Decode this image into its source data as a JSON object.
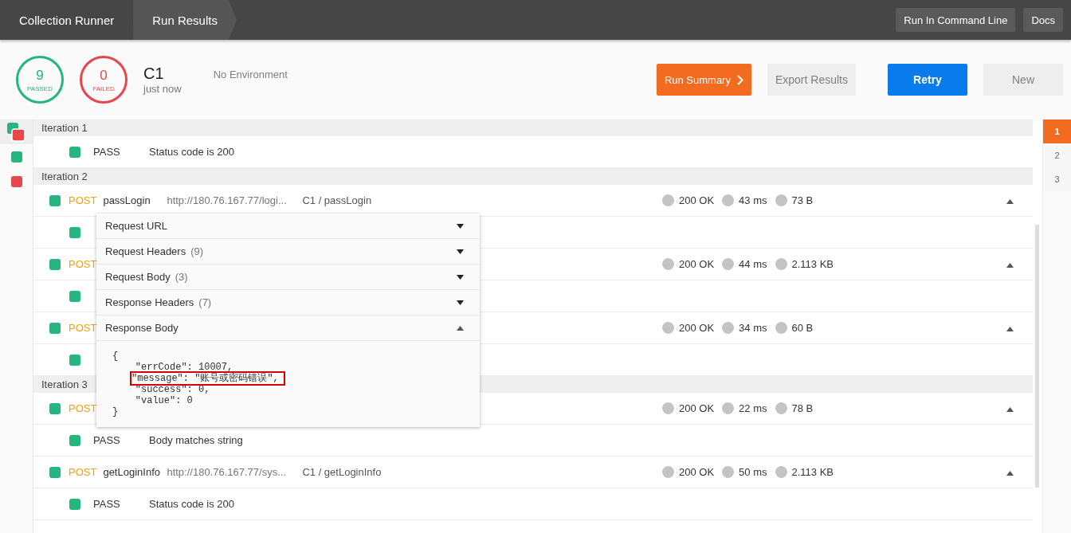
{
  "breadcrumbs": [
    {
      "label": "Collection Runner",
      "selected": false
    },
    {
      "label": "Run Results",
      "selected": true
    }
  ],
  "header_buttons": [
    "Run In Command Line",
    "Docs"
  ],
  "summary": {
    "passed": {
      "count": "9",
      "label": "PASSED"
    },
    "failed": {
      "count": "0",
      "label": "FAILED"
    },
    "collection": "C1",
    "time": "just now",
    "environment": "No Environment"
  },
  "actions": [
    {
      "label": "Run Summary",
      "kind": "summary"
    },
    {
      "label": "Export Results",
      "kind": "secondary"
    },
    {
      "label": "Retry",
      "kind": "primary"
    },
    {
      "label": "New",
      "kind": "secondary"
    }
  ],
  "sidebar": [
    {
      "kind": "mixed",
      "selected": true
    },
    {
      "kind": "pass",
      "selected": false
    },
    {
      "kind": "fail",
      "selected": false
    }
  ],
  "iterations": [
    {
      "title": "Iteration 1",
      "rows": [
        {
          "kind": "test",
          "result": "PASS",
          "name": "Status code is 200"
        }
      ]
    },
    {
      "title": "Iteration 2",
      "rows": [
        {
          "kind": "request",
          "method": "POST",
          "name": "passLogin",
          "url": "http://180.76.167.77/logi...",
          "path": "C1 / passLogin",
          "status": "200 OK",
          "time": "43 ms",
          "size": "73 B",
          "expanded": true
        },
        {
          "kind": "test"
        },
        {
          "kind": "request",
          "method": "POST",
          "status": "200 OK",
          "time": "44 ms",
          "size": "2.113 KB",
          "expanded": true
        },
        {
          "kind": "test"
        },
        {
          "kind": "request",
          "method": "POST",
          "status": "200 OK",
          "time": "34 ms",
          "size": "60 B",
          "expanded": true
        },
        {
          "kind": "test"
        }
      ]
    },
    {
      "title": "Iteration 3",
      "rows": [
        {
          "kind": "request",
          "method": "POST",
          "status": "200 OK",
          "time": "22 ms",
          "size": "78 B",
          "expanded": true
        },
        {
          "kind": "test",
          "result": "PASS",
          "name": "Body matches string"
        },
        {
          "kind": "request",
          "method": "POST",
          "name": "getLoginInfo",
          "url": "http://180.76.167.77/sys...",
          "path": "C1 / getLoginInfo",
          "status": "200 OK",
          "time": "50 ms",
          "size": "2.113 KB",
          "expanded": true
        },
        {
          "kind": "test",
          "result": "PASS",
          "name": "Status code is 200"
        }
      ]
    }
  ],
  "pager": [
    {
      "label": "1",
      "selected": true
    },
    {
      "label": "2",
      "selected": false
    },
    {
      "label": "3",
      "selected": false
    }
  ],
  "details": {
    "sections": [
      {
        "title": "Request URL",
        "expanded": false
      },
      {
        "title": "Request Headers",
        "count": "(9)",
        "expanded": false
      },
      {
        "title": "Request Body",
        "count": "(3)",
        "expanded": false
      },
      {
        "title": "Response Headers",
        "count": "(7)",
        "expanded": false
      },
      {
        "title": "Response Body",
        "expanded": true
      }
    ],
    "response_body": [
      {
        "text": "{",
        "highlighted": false
      },
      {
        "text": "    \"errCode\": 10007,",
        "highlighted": false
      },
      {
        "text": "    \"message\": \"账号或密码错误\",",
        "highlighted": true
      },
      {
        "text": "    \"success\": 0,",
        "highlighted": false
      },
      {
        "text": "    \"value\": 0",
        "highlighted": false
      },
      {
        "text": "}",
        "highlighted": false
      }
    ]
  }
}
